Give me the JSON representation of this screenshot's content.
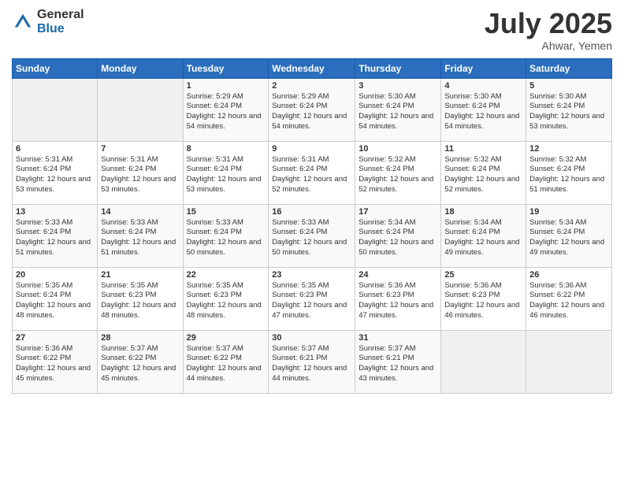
{
  "logo": {
    "general": "General",
    "blue": "Blue"
  },
  "header": {
    "title": "July 2025",
    "location": "Ahwar, Yemen"
  },
  "days": [
    "Sunday",
    "Monday",
    "Tuesday",
    "Wednesday",
    "Thursday",
    "Friday",
    "Saturday"
  ],
  "weeks": [
    [
      {
        "day": "",
        "info": ""
      },
      {
        "day": "",
        "info": ""
      },
      {
        "day": "1",
        "info": "Sunrise: 5:29 AM\nSunset: 6:24 PM\nDaylight: 12 hours and 54 minutes."
      },
      {
        "day": "2",
        "info": "Sunrise: 5:29 AM\nSunset: 6:24 PM\nDaylight: 12 hours and 54 minutes."
      },
      {
        "day": "3",
        "info": "Sunrise: 5:30 AM\nSunset: 6:24 PM\nDaylight: 12 hours and 54 minutes."
      },
      {
        "day": "4",
        "info": "Sunrise: 5:30 AM\nSunset: 6:24 PM\nDaylight: 12 hours and 54 minutes."
      },
      {
        "day": "5",
        "info": "Sunrise: 5:30 AM\nSunset: 6:24 PM\nDaylight: 12 hours and 53 minutes."
      }
    ],
    [
      {
        "day": "6",
        "info": "Sunrise: 5:31 AM\nSunset: 6:24 PM\nDaylight: 12 hours and 53 minutes."
      },
      {
        "day": "7",
        "info": "Sunrise: 5:31 AM\nSunset: 6:24 PM\nDaylight: 12 hours and 53 minutes."
      },
      {
        "day": "8",
        "info": "Sunrise: 5:31 AM\nSunset: 6:24 PM\nDaylight: 12 hours and 53 minutes."
      },
      {
        "day": "9",
        "info": "Sunrise: 5:31 AM\nSunset: 6:24 PM\nDaylight: 12 hours and 52 minutes."
      },
      {
        "day": "10",
        "info": "Sunrise: 5:32 AM\nSunset: 6:24 PM\nDaylight: 12 hours and 52 minutes."
      },
      {
        "day": "11",
        "info": "Sunrise: 5:32 AM\nSunset: 6:24 PM\nDaylight: 12 hours and 52 minutes."
      },
      {
        "day": "12",
        "info": "Sunrise: 5:32 AM\nSunset: 6:24 PM\nDaylight: 12 hours and 51 minutes."
      }
    ],
    [
      {
        "day": "13",
        "info": "Sunrise: 5:33 AM\nSunset: 6:24 PM\nDaylight: 12 hours and 51 minutes."
      },
      {
        "day": "14",
        "info": "Sunrise: 5:33 AM\nSunset: 6:24 PM\nDaylight: 12 hours and 51 minutes."
      },
      {
        "day": "15",
        "info": "Sunrise: 5:33 AM\nSunset: 6:24 PM\nDaylight: 12 hours and 50 minutes."
      },
      {
        "day": "16",
        "info": "Sunrise: 5:33 AM\nSunset: 6:24 PM\nDaylight: 12 hours and 50 minutes."
      },
      {
        "day": "17",
        "info": "Sunrise: 5:34 AM\nSunset: 6:24 PM\nDaylight: 12 hours and 50 minutes."
      },
      {
        "day": "18",
        "info": "Sunrise: 5:34 AM\nSunset: 6:24 PM\nDaylight: 12 hours and 49 minutes."
      },
      {
        "day": "19",
        "info": "Sunrise: 5:34 AM\nSunset: 6:24 PM\nDaylight: 12 hours and 49 minutes."
      }
    ],
    [
      {
        "day": "20",
        "info": "Sunrise: 5:35 AM\nSunset: 6:24 PM\nDaylight: 12 hours and 48 minutes."
      },
      {
        "day": "21",
        "info": "Sunrise: 5:35 AM\nSunset: 6:23 PM\nDaylight: 12 hours and 48 minutes."
      },
      {
        "day": "22",
        "info": "Sunrise: 5:35 AM\nSunset: 6:23 PM\nDaylight: 12 hours and 48 minutes."
      },
      {
        "day": "23",
        "info": "Sunrise: 5:35 AM\nSunset: 6:23 PM\nDaylight: 12 hours and 47 minutes."
      },
      {
        "day": "24",
        "info": "Sunrise: 5:36 AM\nSunset: 6:23 PM\nDaylight: 12 hours and 47 minutes."
      },
      {
        "day": "25",
        "info": "Sunrise: 5:36 AM\nSunset: 6:23 PM\nDaylight: 12 hours and 46 minutes."
      },
      {
        "day": "26",
        "info": "Sunrise: 5:36 AM\nSunset: 6:22 PM\nDaylight: 12 hours and 46 minutes."
      }
    ],
    [
      {
        "day": "27",
        "info": "Sunrise: 5:36 AM\nSunset: 6:22 PM\nDaylight: 12 hours and 45 minutes."
      },
      {
        "day": "28",
        "info": "Sunrise: 5:37 AM\nSunset: 6:22 PM\nDaylight: 12 hours and 45 minutes."
      },
      {
        "day": "29",
        "info": "Sunrise: 5:37 AM\nSunset: 6:22 PM\nDaylight: 12 hours and 44 minutes."
      },
      {
        "day": "30",
        "info": "Sunrise: 5:37 AM\nSunset: 6:21 PM\nDaylight: 12 hours and 44 minutes."
      },
      {
        "day": "31",
        "info": "Sunrise: 5:37 AM\nSunset: 6:21 PM\nDaylight: 12 hours and 43 minutes."
      },
      {
        "day": "",
        "info": ""
      },
      {
        "day": "",
        "info": ""
      }
    ]
  ]
}
